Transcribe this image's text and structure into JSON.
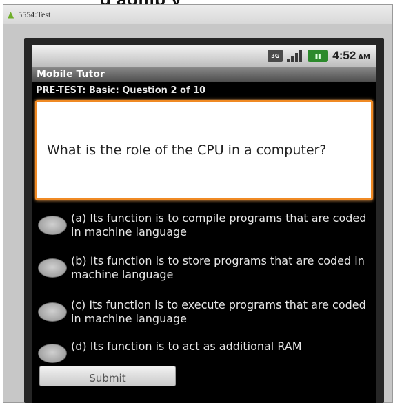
{
  "window": {
    "title": "5554:Test"
  },
  "heading_fragment": "g  aomp    y",
  "status_bar": {
    "time": "4:52",
    "ampm": "AM",
    "icons": [
      "data-3g-icon",
      "signal-icon",
      "battery-icon"
    ]
  },
  "app": {
    "title": "Mobile Tutor",
    "question_header": "PRE-TEST: Basic:  Question 2 of 10",
    "question": "What is the role of the CPU in a computer?",
    "choices": [
      {
        "label": "(a) Its function is to compile programs that are coded in machine language"
      },
      {
        "label": "(b) Its function is to store programs that are coded in machine language"
      },
      {
        "label": "(c) Its function is to execute programs that are coded in machine language"
      },
      {
        "label": "(d) Its function is to act as additional RAM"
      }
    ],
    "submit_label": "Submit"
  },
  "colors": {
    "accent": "#f08a24",
    "screen_bg": "#000000",
    "emulator_bg": "#c7c7c7"
  }
}
